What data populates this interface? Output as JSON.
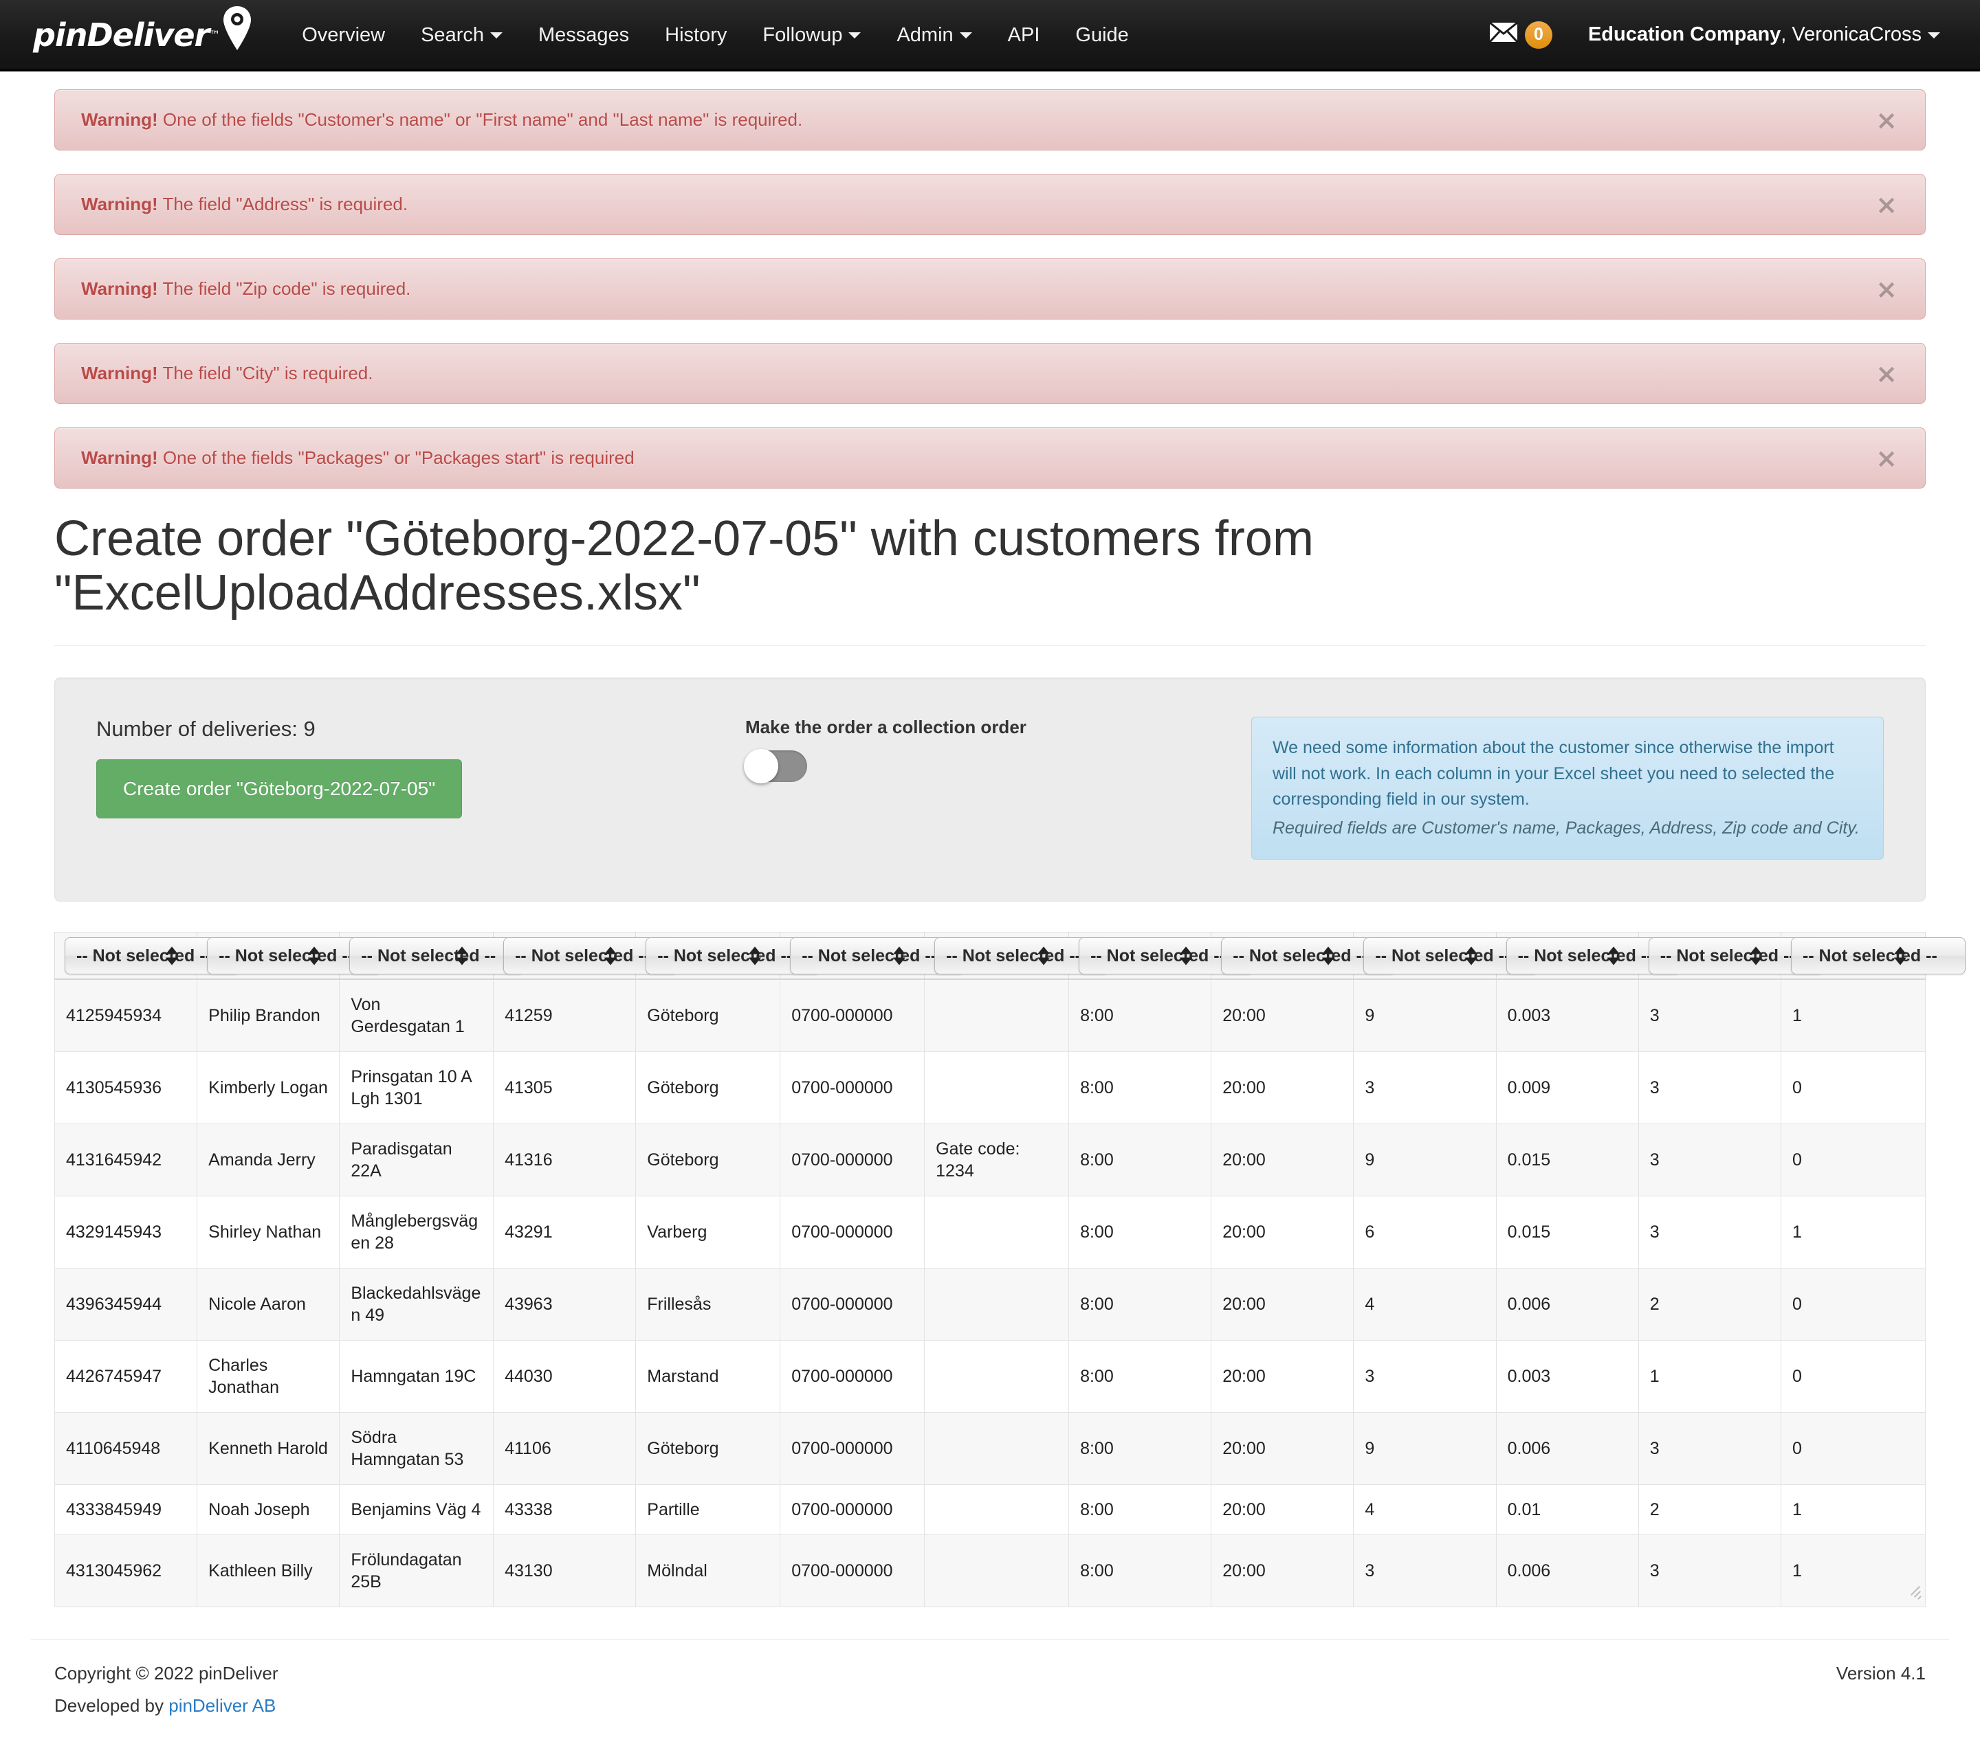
{
  "navbar": {
    "brand": "pinDeliver",
    "brand_tm": "™",
    "links": [
      {
        "label": "Overview",
        "caret": false
      },
      {
        "label": "Search",
        "caret": true
      },
      {
        "label": "Messages",
        "caret": false
      },
      {
        "label": "History",
        "caret": false
      },
      {
        "label": "Followup",
        "caret": true
      },
      {
        "label": "Admin",
        "caret": true
      },
      {
        "label": "API",
        "caret": false
      },
      {
        "label": "Guide",
        "caret": false
      }
    ],
    "messages_icon": "envelope-icon",
    "messages_count": "0",
    "user_company": "Education Company",
    "user_name": ", VeronicaCross"
  },
  "alerts": [
    {
      "strong": "Warning!",
      "text": " One of the fields \"Customer's name\" or \"First name\" and \"Last name\" is required.",
      "close": "×"
    },
    {
      "strong": "Warning!",
      "text": " The field \"Address\" is required.",
      "close": "×"
    },
    {
      "strong": "Warning!",
      "text": " The field \"Zip code\" is required.",
      "close": "×"
    },
    {
      "strong": "Warning!",
      "text": " The field \"City\" is required.",
      "close": "×"
    },
    {
      "strong": "Warning!",
      "text": " One of the fields \"Packages\" or \"Packages start\" is required",
      "close": "×"
    }
  ],
  "page_title": "Create order \"Göteborg-2022-07-05\" with customers from \"ExcelUploadAddresses.xlsx\"",
  "panel": {
    "deliveries_label": "Number of deliveries: 9",
    "create_button": "Create order \"Göteborg-2022-07-05\"",
    "collection_label": "Make the order a collection order",
    "toggle_state": "off",
    "info_text": "We need some information about the customer since otherwise the import will not work. In each column in your Excel sheet you need to selected the corresponding field in our system.",
    "info_required": "Required fields are Customer's name, Packages, Address, Zip code and City."
  },
  "table": {
    "header_select_value": "-- Not selected --",
    "columns": 13,
    "rows": [
      [
        "4125945934",
        "Philip Brandon",
        "Von Gerdesgatan 1",
        "41259",
        "Göteborg",
        "0700-000000",
        "",
        "8:00",
        "20:00",
        "9",
        "0.003",
        "3",
        "1"
      ],
      [
        "4130545936",
        "Kimberly Logan",
        "Prinsgatan 10 A Lgh 1301",
        "41305",
        "Göteborg",
        "0700-000000",
        "",
        "8:00",
        "20:00",
        "3",
        "0.009",
        "3",
        "0"
      ],
      [
        "4131645942",
        "Amanda Jerry",
        "Paradisgatan 22A",
        "41316",
        "Göteborg",
        "0700-000000",
        "Gate code: 1234",
        "8:00",
        "20:00",
        "9",
        "0.015",
        "3",
        "0"
      ],
      [
        "4329145943",
        "Shirley Nathan",
        "Månglebergsvägen 28",
        "43291",
        "Varberg",
        "0700-000000",
        "",
        "8:00",
        "20:00",
        "6",
        "0.015",
        "3",
        "1"
      ],
      [
        "4396345944",
        "Nicole Aaron",
        "Blackedahlsvägen 49",
        "43963",
        "Frillesås",
        "0700-000000",
        "",
        "8:00",
        "20:00",
        "4",
        "0.006",
        "2",
        "0"
      ],
      [
        "4426745947",
        "Charles Jonathan",
        "Hamngatan 19C",
        "44030",
        "Marstand",
        "0700-000000",
        "",
        "8:00",
        "20:00",
        "3",
        "0.003",
        "1",
        "0"
      ],
      [
        "4110645948",
        "Kenneth Harold",
        "Södra Hamngatan 53",
        "41106",
        "Göteborg",
        "0700-000000",
        "",
        "8:00",
        "20:00",
        "9",
        "0.006",
        "3",
        "0"
      ],
      [
        "4333845949",
        "Noah Joseph",
        "Benjamins Väg 4",
        "43338",
        "Partille",
        "0700-000000",
        "",
        "8:00",
        "20:00",
        "4",
        "0.01",
        "2",
        "1"
      ],
      [
        "4313045962",
        "Kathleen Billy",
        "Frölundagatan 25B",
        "43130",
        "Mölndal",
        "0700-000000",
        "",
        "8:00",
        "20:00",
        "3",
        "0.006",
        "3",
        "1"
      ]
    ]
  },
  "footer": {
    "copyright": "Copyright © 2022 pinDeliver",
    "developed_prefix": "Developed by ",
    "developed_link": "pinDeliver AB",
    "version": "Version 4.1"
  }
}
